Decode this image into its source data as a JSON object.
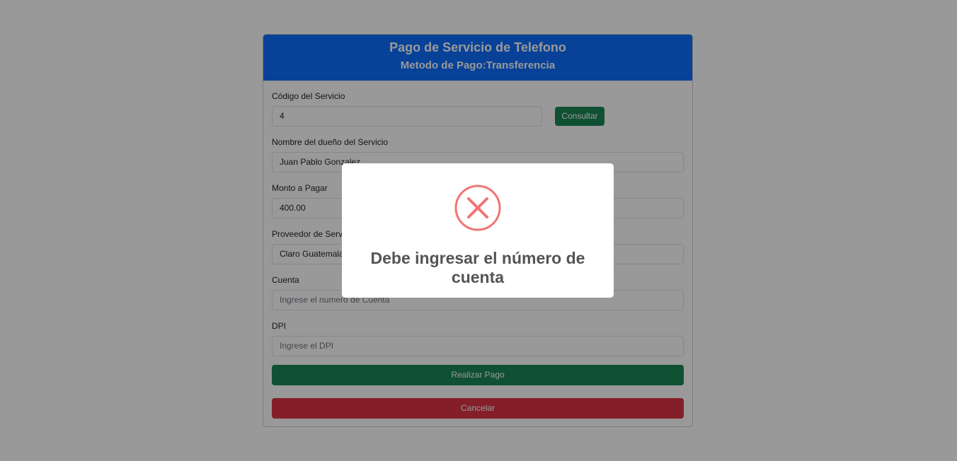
{
  "header": {
    "title": "Pago de Servicio de Telefono",
    "subtitle": "Metodo de Pago:Transferencia"
  },
  "form": {
    "codigo_label": "Código del Servicio",
    "codigo_value": "4",
    "consultar_label": "Consultar",
    "nombre_label": "Nombre del dueño del Servicio",
    "nombre_value": "Juan Pablo Gonzalez",
    "monto_label": "Monto a Pagar",
    "monto_value": "400.00",
    "proveedor_label": "Proveedor de Servicio",
    "proveedor_value": "Claro Guatemala",
    "cuenta_label": "Cuenta",
    "cuenta_placeholder": "Ingrese el numero de Cuenta",
    "dpi_label": "DPI",
    "dpi_placeholder": "Ingrese el DPI",
    "pagar_label": "Realizar Pago",
    "cancelar_label": "Cancelar"
  },
  "modal": {
    "icon": "error-x-icon",
    "message": "Debe ingresar el número de cuenta"
  },
  "colors": {
    "header": "#0d6efd",
    "success": "#198754",
    "danger": "#dc3545",
    "error_icon": "#f27474"
  }
}
